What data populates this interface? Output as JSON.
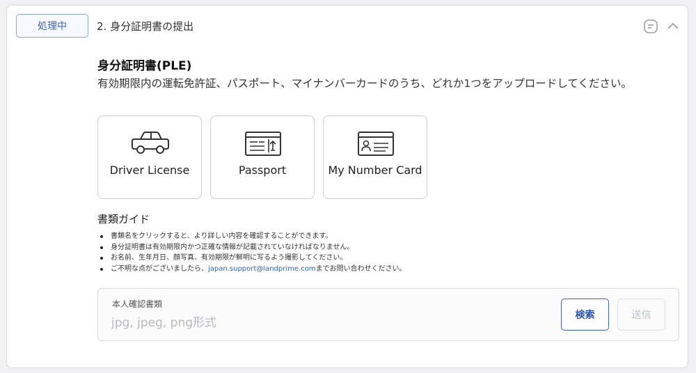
{
  "header": {
    "status": "処理中",
    "step_title": "2. 身分証明書の提出",
    "icons": [
      "document-icon",
      "chevron-up-icon"
    ]
  },
  "section": {
    "title": "身分証明書(PLE)",
    "description": "有効期限内の運転免許証、パスポート、マイナンバーカードのうち、どれか1つをアップロードしてください。"
  },
  "documents": [
    {
      "label": "Driver License",
      "icon": "car-icon"
    },
    {
      "label": "Passport",
      "icon": "passport-icon"
    },
    {
      "label": "My Number Card",
      "icon": "id-card-icon"
    }
  ],
  "guide": {
    "title": "書類ガイド",
    "items": [
      "書類名をクリックすると、より詳しい内容を確認することができます。",
      "身分証明書は有効期限内かつ正確な情報が記載されていなければなりません。",
      "お名前、生年月日、顔写真、有効期限が鮮明に写るよう撮影してください。"
    ],
    "last_item_prefix": "ご不明な点がございましたら、",
    "email": "japan.support@landprime.com",
    "last_item_suffix": "までお問い合わせください。"
  },
  "upload": {
    "label": "本人確認書類",
    "placeholder": "jpg, jpeg, png形式",
    "search_label": "検索",
    "send_label": "送信"
  },
  "colors": {
    "accent": "#3b5fb8",
    "badge_bg": "#f6f9ff",
    "link": "#2f62b6"
  }
}
